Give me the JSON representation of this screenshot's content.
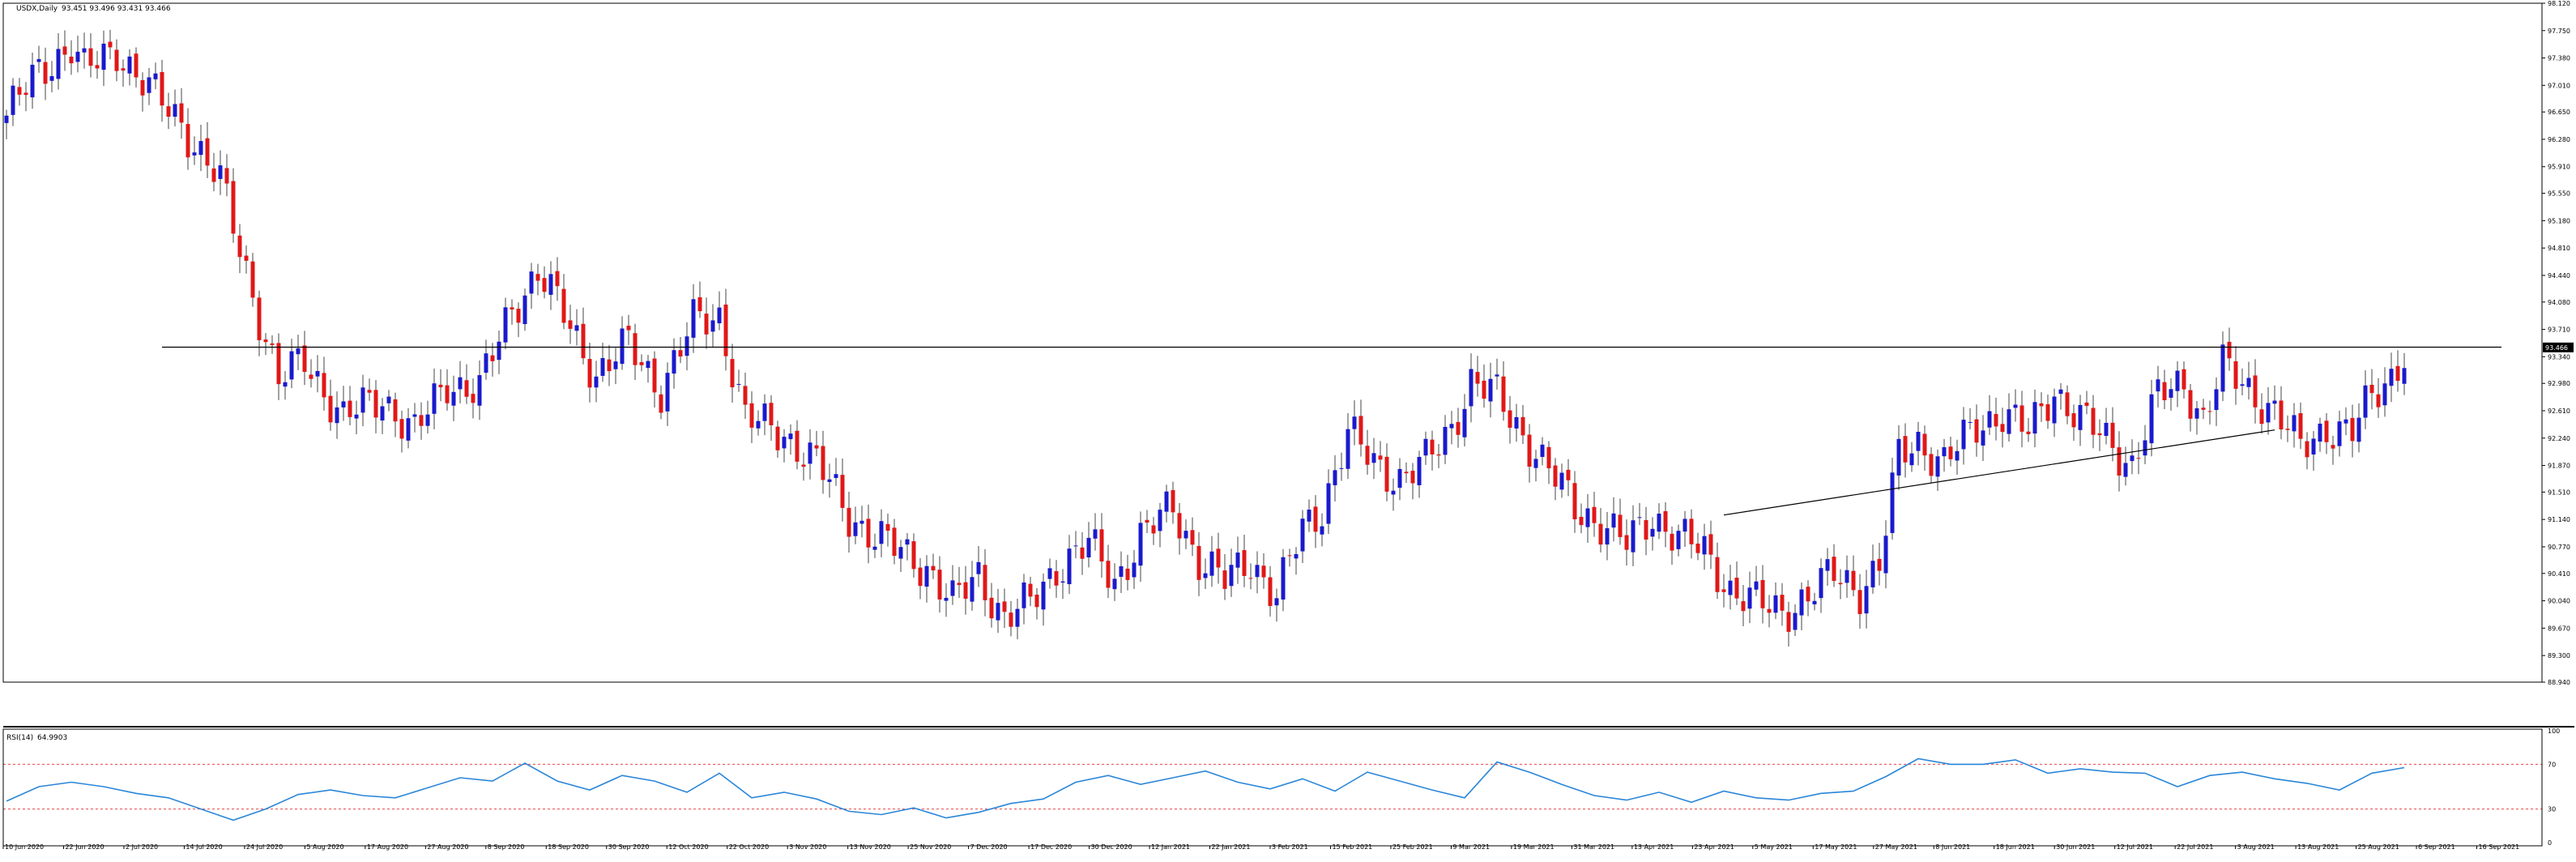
{
  "header": {
    "symbol_label": "USDX,Daily",
    "ohlc_values": "93.451 93.496 93.431 93.466"
  },
  "indicator": {
    "label": "RSI(14)",
    "value": "64.9903"
  },
  "colors": {
    "bull": "#1a1acc",
    "bear": "#e01818",
    "wick": "#444444",
    "rsi_line": "#2a86d8",
    "level_line": "#e84545",
    "price_tag_bg": "#000000",
    "frame": "#000000",
    "trendline": "#000000"
  },
  "chart_data": [
    {
      "type": "candlestick",
      "title": "USDX,Daily",
      "ylim": [
        88.94,
        98.12
      ],
      "y_ticks": [
        98.12,
        97.75,
        97.38,
        97.01,
        96.65,
        96.28,
        95.91,
        95.55,
        95.18,
        94.81,
        94.44,
        94.08,
        93.71,
        93.34,
        92.98,
        92.61,
        92.24,
        91.87,
        91.51,
        91.14,
        90.77,
        90.41,
        90.04,
        89.67,
        89.3,
        88.94
      ],
      "current_price": 93.466,
      "x_ticks": [
        "10 Jun 2020",
        "22 Jun 2020",
        "2 Jul 2020",
        "14 Jul 2020",
        "24 Jul 2020",
        "5 Aug 2020",
        "17 Aug 2020",
        "27 Aug 2020",
        "8 Sep 2020",
        "18 Sep 2020",
        "30 Sep 2020",
        "12 Oct 2020",
        "22 Oct 2020",
        "3 Nov 2020",
        "13 Nov 2020",
        "25 Nov 2020",
        "7 Dec 2020",
        "17 Dec 2020",
        "30 Dec 2020",
        "12 Jan 2021",
        "22 Jan 2021",
        "3 Feb 2021",
        "15 Feb 2021",
        "25 Feb 2021",
        "9 Mar 2021",
        "19 Mar 2021",
        "31 Mar 2021",
        "13 Apr 2021",
        "23 Apr 2021",
        "5 May 2021",
        "17 May 2021",
        "27 May 2021",
        "8 Jun 2021",
        "18 Jun 2021",
        "30 Jun 2021",
        "12 Jul 2021",
        "22 Jul 2021",
        "3 Aug 2021",
        "13 Aug 2021",
        "25 Aug 2021",
        "6 Sep 2021",
        "16 Sep 2021"
      ],
      "close_path": [
        [
          0,
          96.6
        ],
        [
          5,
          97.2
        ],
        [
          10,
          97.55
        ],
        [
          12,
          97.2
        ],
        [
          17,
          97.5
        ],
        [
          22,
          96.95
        ],
        [
          27,
          96.5
        ],
        [
          33,
          95.7
        ],
        [
          38,
          94.2
        ],
        [
          42,
          93.0
        ],
        [
          46,
          93.3
        ],
        [
          52,
          92.5
        ],
        [
          58,
          92.8
        ],
        [
          63,
          92.3
        ],
        [
          68,
          93.0
        ],
        [
          73,
          92.9
        ],
        [
          78,
          94.0
        ],
        [
          82,
          94.5
        ],
        [
          86,
          93.9
        ],
        [
          91,
          93.1
        ],
        [
          96,
          93.5
        ],
        [
          101,
          92.9
        ],
        [
          106,
          93.8
        ],
        [
          110,
          93.9
        ],
        [
          114,
          92.5
        ],
        [
          120,
          92.3
        ],
        [
          125,
          91.9
        ],
        [
          130,
          91.2
        ],
        [
          134,
          90.9
        ],
        [
          138,
          90.7
        ],
        [
          142,
          90.5
        ],
        [
          146,
          90.0
        ],
        [
          150,
          90.4
        ],
        [
          154,
          89.8
        ],
        [
          158,
          90.0
        ],
        [
          162,
          90.5
        ],
        [
          167,
          90.8
        ],
        [
          171,
          90.3
        ],
        [
          175,
          90.9
        ],
        [
          180,
          91.3
        ],
        [
          184,
          90.6
        ],
        [
          188,
          90.3
        ],
        [
          192,
          90.6
        ],
        [
          196,
          90.1
        ],
        [
          200,
          91.0
        ],
        [
          203,
          91.3
        ],
        [
          207,
          92.3
        ],
        [
          211,
          91.9
        ],
        [
          215,
          91.7
        ],
        [
          219,
          91.9
        ],
        [
          223,
          92.4
        ],
        [
          226,
          93.0
        ],
        [
          230,
          92.8
        ],
        [
          234,
          92.3
        ],
        [
          238,
          91.8
        ],
        [
          242,
          91.3
        ],
        [
          246,
          91.1
        ],
        [
          250,
          90.8
        ],
        [
          254,
          91.2
        ],
        [
          258,
          90.9
        ],
        [
          262,
          90.7
        ],
        [
          266,
          90.2
        ],
        [
          270,
          90.0
        ],
        [
          274,
          89.9
        ],
        [
          278,
          90.1
        ],
        [
          282,
          90.4
        ],
        [
          286,
          90.2
        ],
        [
          289,
          90.5
        ],
        [
          292,
          92.0
        ],
        [
          295,
          92.2
        ],
        [
          299,
          91.9
        ],
        [
          304,
          92.4
        ],
        [
          308,
          92.6
        ],
        [
          312,
          92.3
        ],
        [
          316,
          92.9
        ],
        [
          320,
          92.5
        ],
        [
          324,
          92.2
        ],
        [
          328,
          91.9
        ],
        [
          332,
          92.8
        ],
        [
          336,
          93.0
        ],
        [
          339,
          92.5
        ],
        [
          342,
          93.2
        ],
        [
          346,
          92.9
        ],
        [
          350,
          92.6
        ],
        [
          354,
          92.1
        ],
        [
          358,
          92.4
        ],
        [
          362,
          92.3
        ],
        [
          365,
          92.8
        ],
        [
          368,
          93.1
        ],
        [
          370,
          93.4
        ]
      ],
      "trendlines": [
        {
          "name": "resistance",
          "start": [
            24,
            93.47
          ],
          "end": [
            385,
            93.47
          ]
        },
        {
          "name": "rising-support",
          "start": [
            265,
            91.2
          ],
          "end": [
            350,
            92.35
          ]
        }
      ]
    },
    {
      "type": "line",
      "title": "RSI(14)",
      "ylim": [
        0,
        100
      ],
      "y_ticks": [
        100,
        70,
        30,
        0
      ],
      "levels": [
        70,
        30
      ],
      "x": [
        0,
        5,
        10,
        15,
        20,
        25,
        30,
        35,
        40,
        45,
        50,
        55,
        60,
        65,
        70,
        75,
        80,
        85,
        90,
        95,
        100,
        105,
        110,
        115,
        120,
        125,
        130,
        135,
        140,
        145,
        150,
        155,
        160,
        165,
        170,
        175,
        180,
        185,
        190,
        195,
        200,
        205,
        210,
        215,
        220,
        225,
        230,
        235,
        240,
        245,
        250,
        255,
        260,
        265,
        270,
        275,
        280,
        285,
        290,
        295,
        300,
        305,
        310,
        315,
        320,
        325,
        330,
        335,
        340,
        345,
        350,
        355,
        360,
        365,
        370
      ],
      "values": [
        37,
        50,
        54,
        50,
        44,
        40,
        30,
        20,
        30,
        43,
        47,
        42,
        40,
        49,
        58,
        55,
        71,
        55,
        47,
        60,
        55,
        45,
        62,
        40,
        45,
        39,
        28,
        25,
        31,
        22,
        27,
        35,
        39,
        54,
        60,
        52,
        58,
        64,
        54,
        48,
        57,
        46,
        63,
        55,
        47,
        40,
        72,
        63,
        52,
        42,
        38,
        45,
        36,
        46,
        40,
        38,
        44,
        46,
        59,
        75,
        70,
        70,
        74,
        62,
        66,
        63,
        62,
        50,
        60,
        63,
        57,
        53,
        47,
        62,
        67
      ]
    }
  ]
}
